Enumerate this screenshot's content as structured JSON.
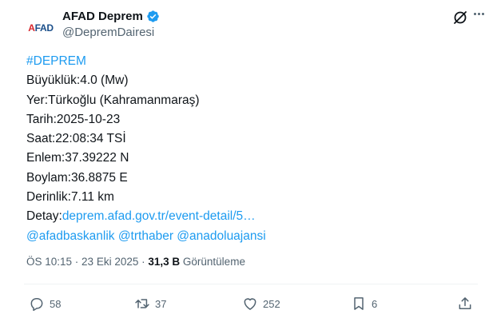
{
  "author": {
    "avatar_text_a": "A",
    "avatar_text_rest": "FAD",
    "display_name": "AFAD Deprem",
    "handle": "@DepremDairesi",
    "verified": true
  },
  "tweet": {
    "hashtag": "#DEPREM",
    "lines": [
      "Büyüklük:4.0 (Mw)",
      "Yer:Türkoğlu (Kahramanmaraş)",
      "Tarih:2025-10-23",
      "Saat:22:08:34 TSİ",
      "Enlem:37.39222 N",
      "Boylam:36.8875 E",
      "Derinlik:7.11 km"
    ],
    "detail_label": "Detay:",
    "detail_link": "deprem.afad.gov.tr/event-detail/5…",
    "mentions": "@afadbaskanlik @trthaber @anadoluajansi"
  },
  "meta": {
    "time": "ÖS 10:15",
    "separator": " · ",
    "date": "23 Eki 2025",
    "views_count": "31,3 B",
    "views_label": "Görüntüleme"
  },
  "actions": {
    "replies": "58",
    "reposts": "37",
    "likes": "252",
    "bookmarks": "6"
  },
  "colors": {
    "link": "#1d9bf0",
    "text": "#0f1419",
    "secondary": "#536471"
  }
}
